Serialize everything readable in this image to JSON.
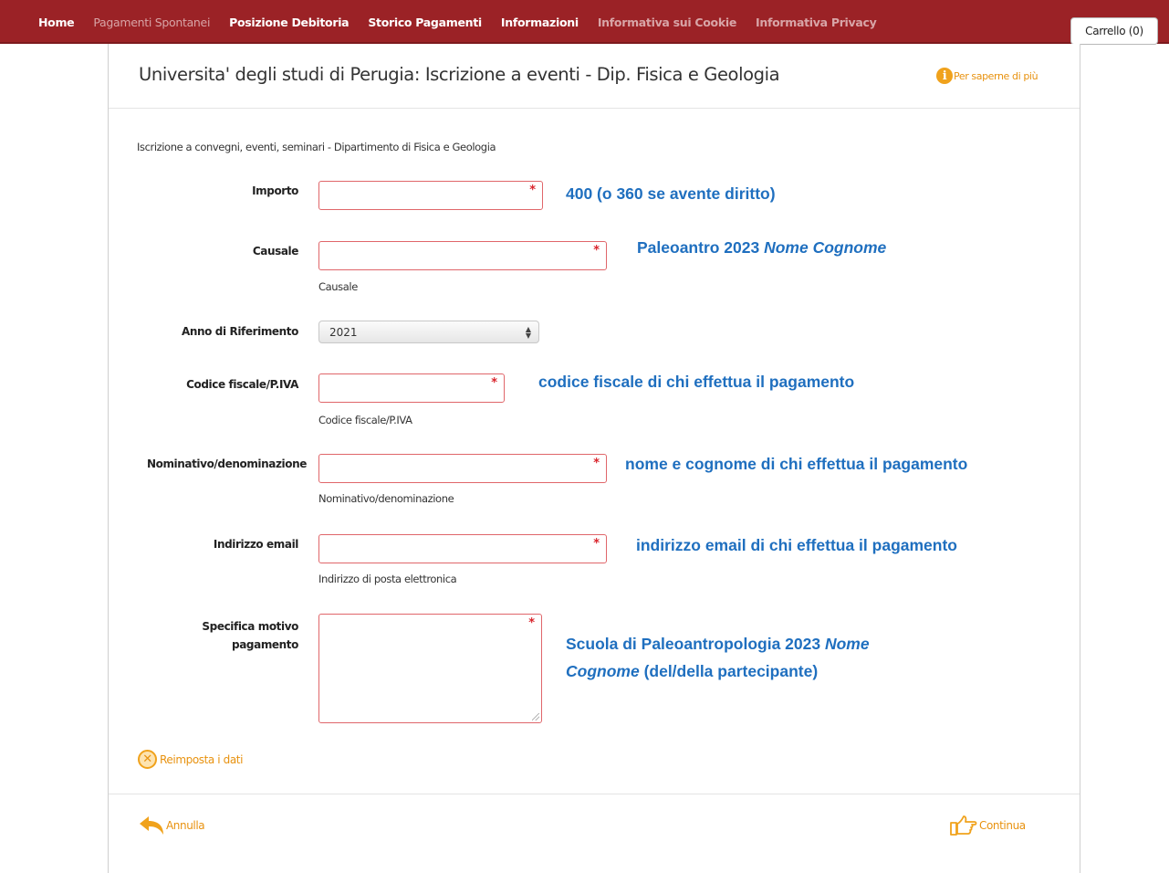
{
  "nav": {
    "items": [
      {
        "label": "Home",
        "style": "active"
      },
      {
        "label": "Pagamenti Spontanei",
        "style": "muted"
      },
      {
        "label": "Posizione Debitoria",
        "style": "active"
      },
      {
        "label": "Storico Pagamenti",
        "style": "active"
      },
      {
        "label": "Informazioni",
        "style": "active"
      },
      {
        "label": "Informativa sui Cookie",
        "style": "muted-bold"
      },
      {
        "label": "Informativa Privacy",
        "style": "muted-bold"
      }
    ],
    "cart_label": "Carrello (0)"
  },
  "header": {
    "title": "Universita' degli studi di Perugia: Iscrizione a eventi - Dip. Fisica e Geologia",
    "info_link": "Per saperne di più",
    "info_icon": "info-icon"
  },
  "form": {
    "subtitle": "Iscrizione a convegni, eventi, seminari - Dipartimento di Fisica e Geologia",
    "required_mark": "*",
    "importo": {
      "label": "Importo",
      "value": "",
      "note": "400 (o 360 se avente diritto)"
    },
    "causale": {
      "label": "Causale",
      "value": "",
      "helper": "Causale",
      "note_prefix": "Paleoantro 2023 ",
      "note_italic": "Nome Cognome"
    },
    "anno": {
      "label": "Anno di Riferimento",
      "selected": "2021"
    },
    "codice_fiscale": {
      "label": "Codice fiscale/P.IVA",
      "value": "",
      "helper": "Codice fiscale/P.IVA",
      "note": "codice fiscale di chi effettua il pagamento"
    },
    "nominativo": {
      "label": "Nominativo/denominazione",
      "value": "",
      "helper": "Nominativo/denominazione",
      "note": "nome e cognome di chi effettua il pagamento"
    },
    "email": {
      "label": "Indirizzo email",
      "value": "",
      "helper": "Indirizzo di posta elettronica",
      "note": "indirizzo email di chi effettua il pagamento"
    },
    "motivo": {
      "label_line1": "Specifica motivo",
      "label_line2": "pagamento",
      "value": "",
      "note_line1_prefix": "Scuola di Paleoantropologia 2023 ",
      "note_line1_italic": "Nome",
      "note_line2_italic": "Cognome",
      "note_line2_suffix": " (del/della partecipante)"
    }
  },
  "actions": {
    "reset_label": "Reimposta i dati",
    "cancel_label": "Annulla",
    "continue_label": "Continua",
    "accent_color": "#e8920f"
  },
  "colors": {
    "topbar": "#9b2226",
    "note_text": "#1f6fbf",
    "required": "#d9242c",
    "field_border": "#e0666a"
  }
}
